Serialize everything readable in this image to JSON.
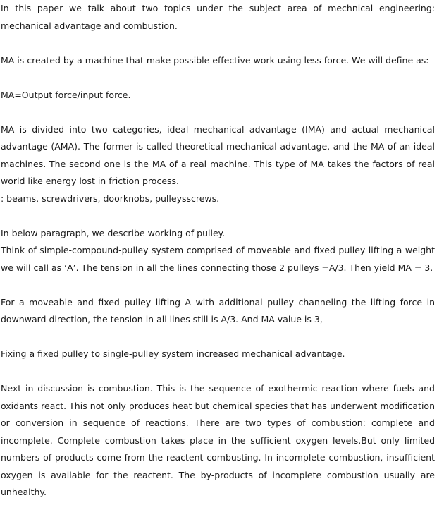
{
  "article": {
    "p1": "In this paper we talk about two topics under the subject area of mechnical engineering: mechanical advantage and combustion.",
    "p2": "MA is created by a machine that make possible effective work using less force. We will define as:",
    "p3": "MA=Output force/input force.",
    "p4": "MA is divided into two categories, ideal mechanical advantage (IMA) and actual mechanical advantage (AMA). The former is called theoretical mechanical advantage, and the MA of an ideal machines. The second one is the MA of a real machine. This type of MA takes the factors of real world like energy lost in friction process.",
    "p5": ": beams, screwdrivers, doorknobs, pulleysscrews.",
    "p6": "In below paragraph, we describe working of pulley.",
    "p7": "Think of simple-compound-pulley system comprised of moveable and fixed pulley lifting a weight we will call as ‘A’. The tension in all the lines connecting those 2 pulleys =A/3. Then yield MA = 3.",
    "p8": "For a moveable and fixed pulley lifting A with additional pulley channeling the lifting force in downward direction, the tension in all lines still is A/3. And MA value is 3,",
    "p9": "Fixing a fixed pulley to single-pulley system increased mechanical advantage.",
    "p10": "Next in discussion is combustion. This is the sequence of exothermic reaction where fuels and oxidants react. This not only produces heat but chemical species that has underwent modification or conversion in sequence of reactions. There are two types of combustion: complete and incomplete. Complete combustion takes place in the sufficient oxygen levels.But only limited numbers of products come from the reactent combusting. In incomplete combustion, insufficient oxygen is available for the reactent. The by-products of incomplete combustion usually are unhealthy."
  }
}
